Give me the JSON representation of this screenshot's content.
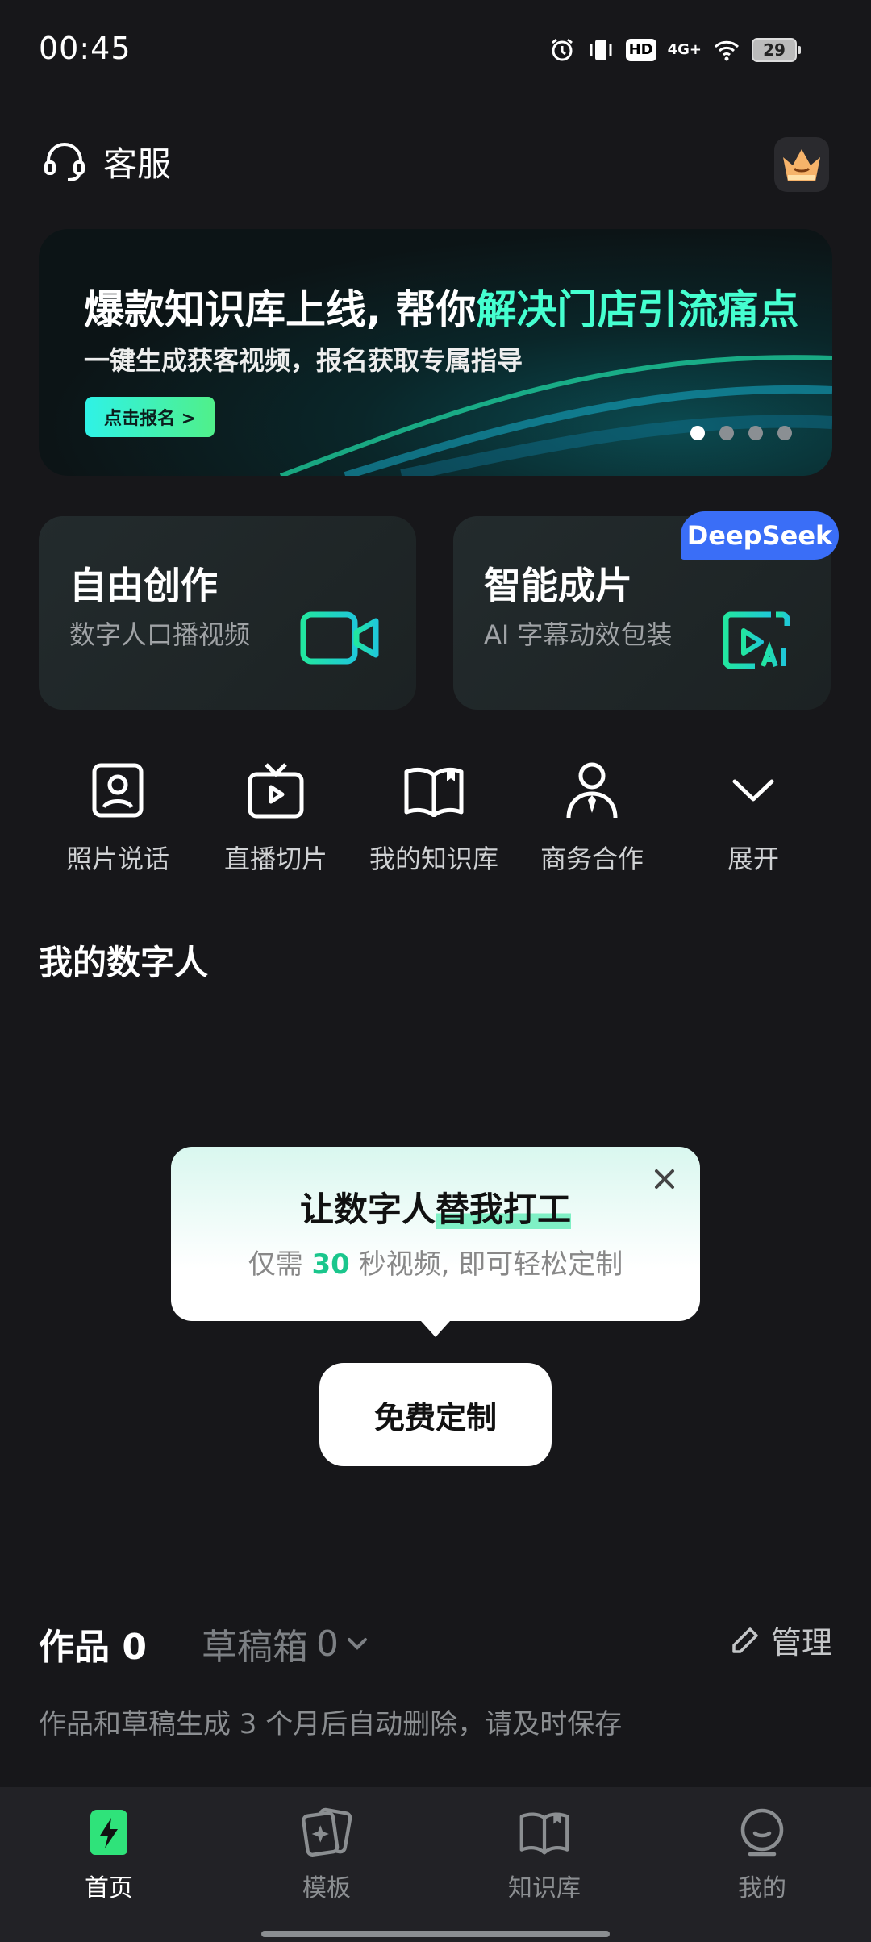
{
  "status_bar": {
    "time": "00:45",
    "network": "4G+",
    "hd": "HD",
    "battery": "29"
  },
  "header": {
    "service_label": "客服"
  },
  "banner": {
    "title_part1": "爆款知识库上线, 帮你",
    "title_part2": "解决门店引流痛点",
    "subtitle": "一键生成获客视频，报名获取专属指导",
    "button": "点击报名 >",
    "pages": 4,
    "active_page": 1
  },
  "cards": [
    {
      "title": "自由创作",
      "subtitle": "数字人口播视频"
    },
    {
      "title": "智能成片",
      "subtitle": "AI 字幕动效包装",
      "badge": "DeepSeek"
    }
  ],
  "quick_actions": [
    {
      "label": "照片说话",
      "icon": "portrait-icon"
    },
    {
      "label": "直播切片",
      "icon": "tv-play-icon"
    },
    {
      "label": "我的知识库",
      "icon": "book-icon"
    },
    {
      "label": "商务合作",
      "icon": "business-person-icon"
    },
    {
      "label": "展开",
      "icon": "chevron-down-icon"
    }
  ],
  "section_title": "我的数字人",
  "popup": {
    "title_a": "让数字人",
    "title_b": "替我打工",
    "sub_a": "仅需 ",
    "sub_num": "30",
    "sub_b": " 秒视频, 即可轻松定制"
  },
  "free_button": "免费定制",
  "works": {
    "works_label": "作品",
    "works_count": "0",
    "drafts_label": "草稿箱",
    "drafts_count": "0",
    "manage": "管理",
    "note": "作品和草稿生成 3 个月后自动删除，请及时保存"
  },
  "nav": [
    {
      "label": "首页",
      "icon": "home-bolt-icon",
      "active": true
    },
    {
      "label": "模板",
      "icon": "template-cards-icon"
    },
    {
      "label": "知识库",
      "icon": "knowledge-book-icon"
    },
    {
      "label": "我的",
      "icon": "profile-face-icon"
    }
  ],
  "colors": {
    "accent": "#45ffd0",
    "green": "#1ac68c",
    "badge_blue": "#3a6ef7",
    "background": "#17171a"
  }
}
